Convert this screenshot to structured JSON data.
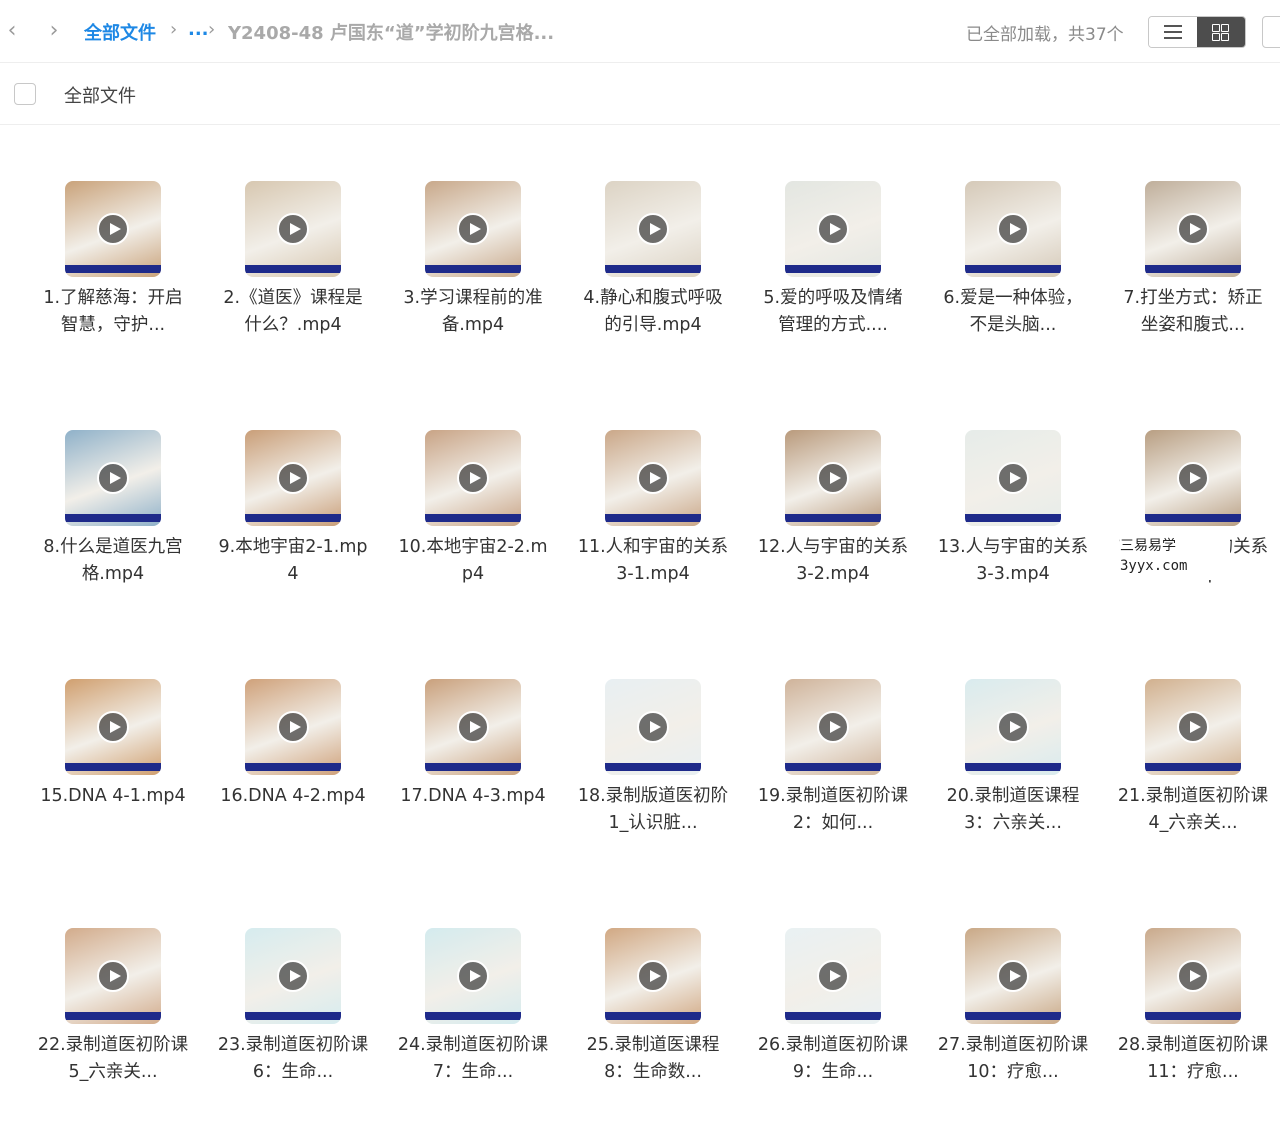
{
  "toolbar": {
    "back_icon": "chevron-left-icon",
    "forward_icon": "chevron-right-icon",
    "breadcrumb_root": "全部文件",
    "breadcrumb_ellipsis": "...",
    "breadcrumb_current": "Y2408-48 卢国东“道”学初阶九宫格...",
    "load_status": "已全部加载，共37个",
    "view_list_icon": "list-view-icon",
    "view_grid_icon": "grid-view-icon"
  },
  "selectbar": {
    "label": "全部文件"
  },
  "watermark": {
    "line1": "三易易学",
    "line2": "3yyx.com"
  },
  "files": [
    {
      "name": "1.了解慈海：开启智慧，守护...",
      "thumb": "#c9a27a"
    },
    {
      "name": "2.《道医》课程是什么？.mp4",
      "thumb": "#d7c7b0"
    },
    {
      "name": "3.学习课程前的准备.mp4",
      "thumb": "#c8a88a"
    },
    {
      "name": "4.静心和腹式呼吸的引导.mp4",
      "thumb": "#dcd3c4"
    },
    {
      "name": "5.爱的呼吸及情绪管理的方式....",
      "thumb": "#e3e6e1"
    },
    {
      "name": "6.爱是一种体验，不是头脑...",
      "thumb": "#d5c9b8"
    },
    {
      "name": "7.打坐方式：矫正坐姿和腹式...",
      "thumb": "#bfae9a"
    },
    {
      "name": "8.什么是道医九宫格.mp4",
      "thumb": "#8fb1c9"
    },
    {
      "name": "9.本地宇宙2-1.mp4",
      "thumb": "#c99e78"
    },
    {
      "name": "10.本地宇宙2-2.mp4",
      "thumb": "#c8a385"
    },
    {
      "name": "11.人和宇宙的关系3-1.mp4",
      "thumb": "#caa788"
    },
    {
      "name": "12.人与宇宙的关系3-2.mp4",
      "thumb": "#b99a7c"
    },
    {
      "name": "13.人与宇宙的关系3-3.mp4",
      "thumb": "#e6ece9"
    },
    {
      "name": "14.人与宇宙的关系3-3.mp4",
      "thumb": "#b89e82"
    },
    {
      "name": "15.DNA 4-1.mp4",
      "thumb": "#d09f6f"
    },
    {
      "name": "16.DNA 4-2.mp4",
      "thumb": "#cfa17a"
    },
    {
      "name": "17.DNA 4-3.mp4",
      "thumb": "#c9a07c"
    },
    {
      "name": "18.录制版道医初阶1_认识脏...",
      "thumb": "#e8eff2"
    },
    {
      "name": "19.录制道医初阶课2：如何...",
      "thumb": "#cfb39a"
    },
    {
      "name": "20.录制道医课程3：六亲关...",
      "thumb": "#d9ebee"
    },
    {
      "name": "21.录制道医初阶课4_六亲关...",
      "thumb": "#d1b08e"
    },
    {
      "name": "22.录制道医初阶课5_六亲关...",
      "thumb": "#d2ab8b"
    },
    {
      "name": "23.录制道医初阶课6：生命...",
      "thumb": "#d6ecef"
    },
    {
      "name": "24.录制道医初阶课7：生命...",
      "thumb": "#d4ebee"
    },
    {
      "name": "25.录制道医课程8：生命数...",
      "thumb": "#d1a883"
    },
    {
      "name": "26.录制道医初阶课9：生命...",
      "thumb": "#e9f1f3"
    },
    {
      "name": "27.录制道医初阶课10：疗愈...",
      "thumb": "#c9a886"
    },
    {
      "name": "28.录制道医初阶课11：疗愈...",
      "thumb": "#c9a98b"
    }
  ]
}
